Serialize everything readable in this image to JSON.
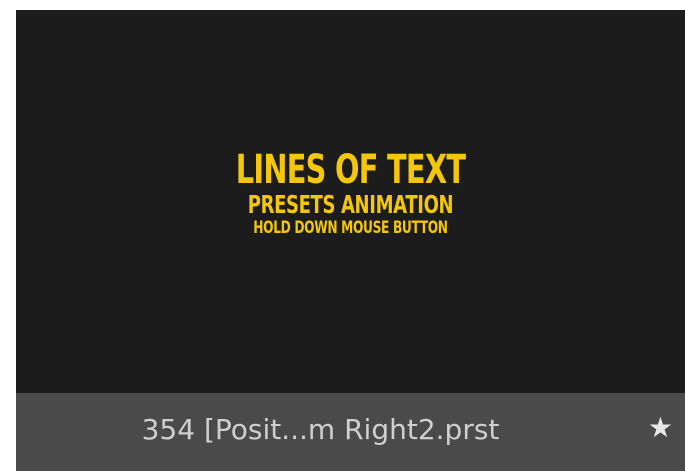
{
  "preset_tile": {
    "preview": {
      "line1": "LINES OF TEXT",
      "line2": "PRESETS ANIMATION",
      "line3": "HOLD DOWN MOUSE BUTTON"
    },
    "filename": "354 [Posit...m Right2.prst",
    "favorite_icon": "★"
  },
  "colors": {
    "preview_background": "#1c1c1c",
    "preview_text": "#f4c60c",
    "caption_background": "#4a4a4a",
    "caption_text": "#cfcfcf"
  },
  "icons": [
    "star-icon"
  ]
}
